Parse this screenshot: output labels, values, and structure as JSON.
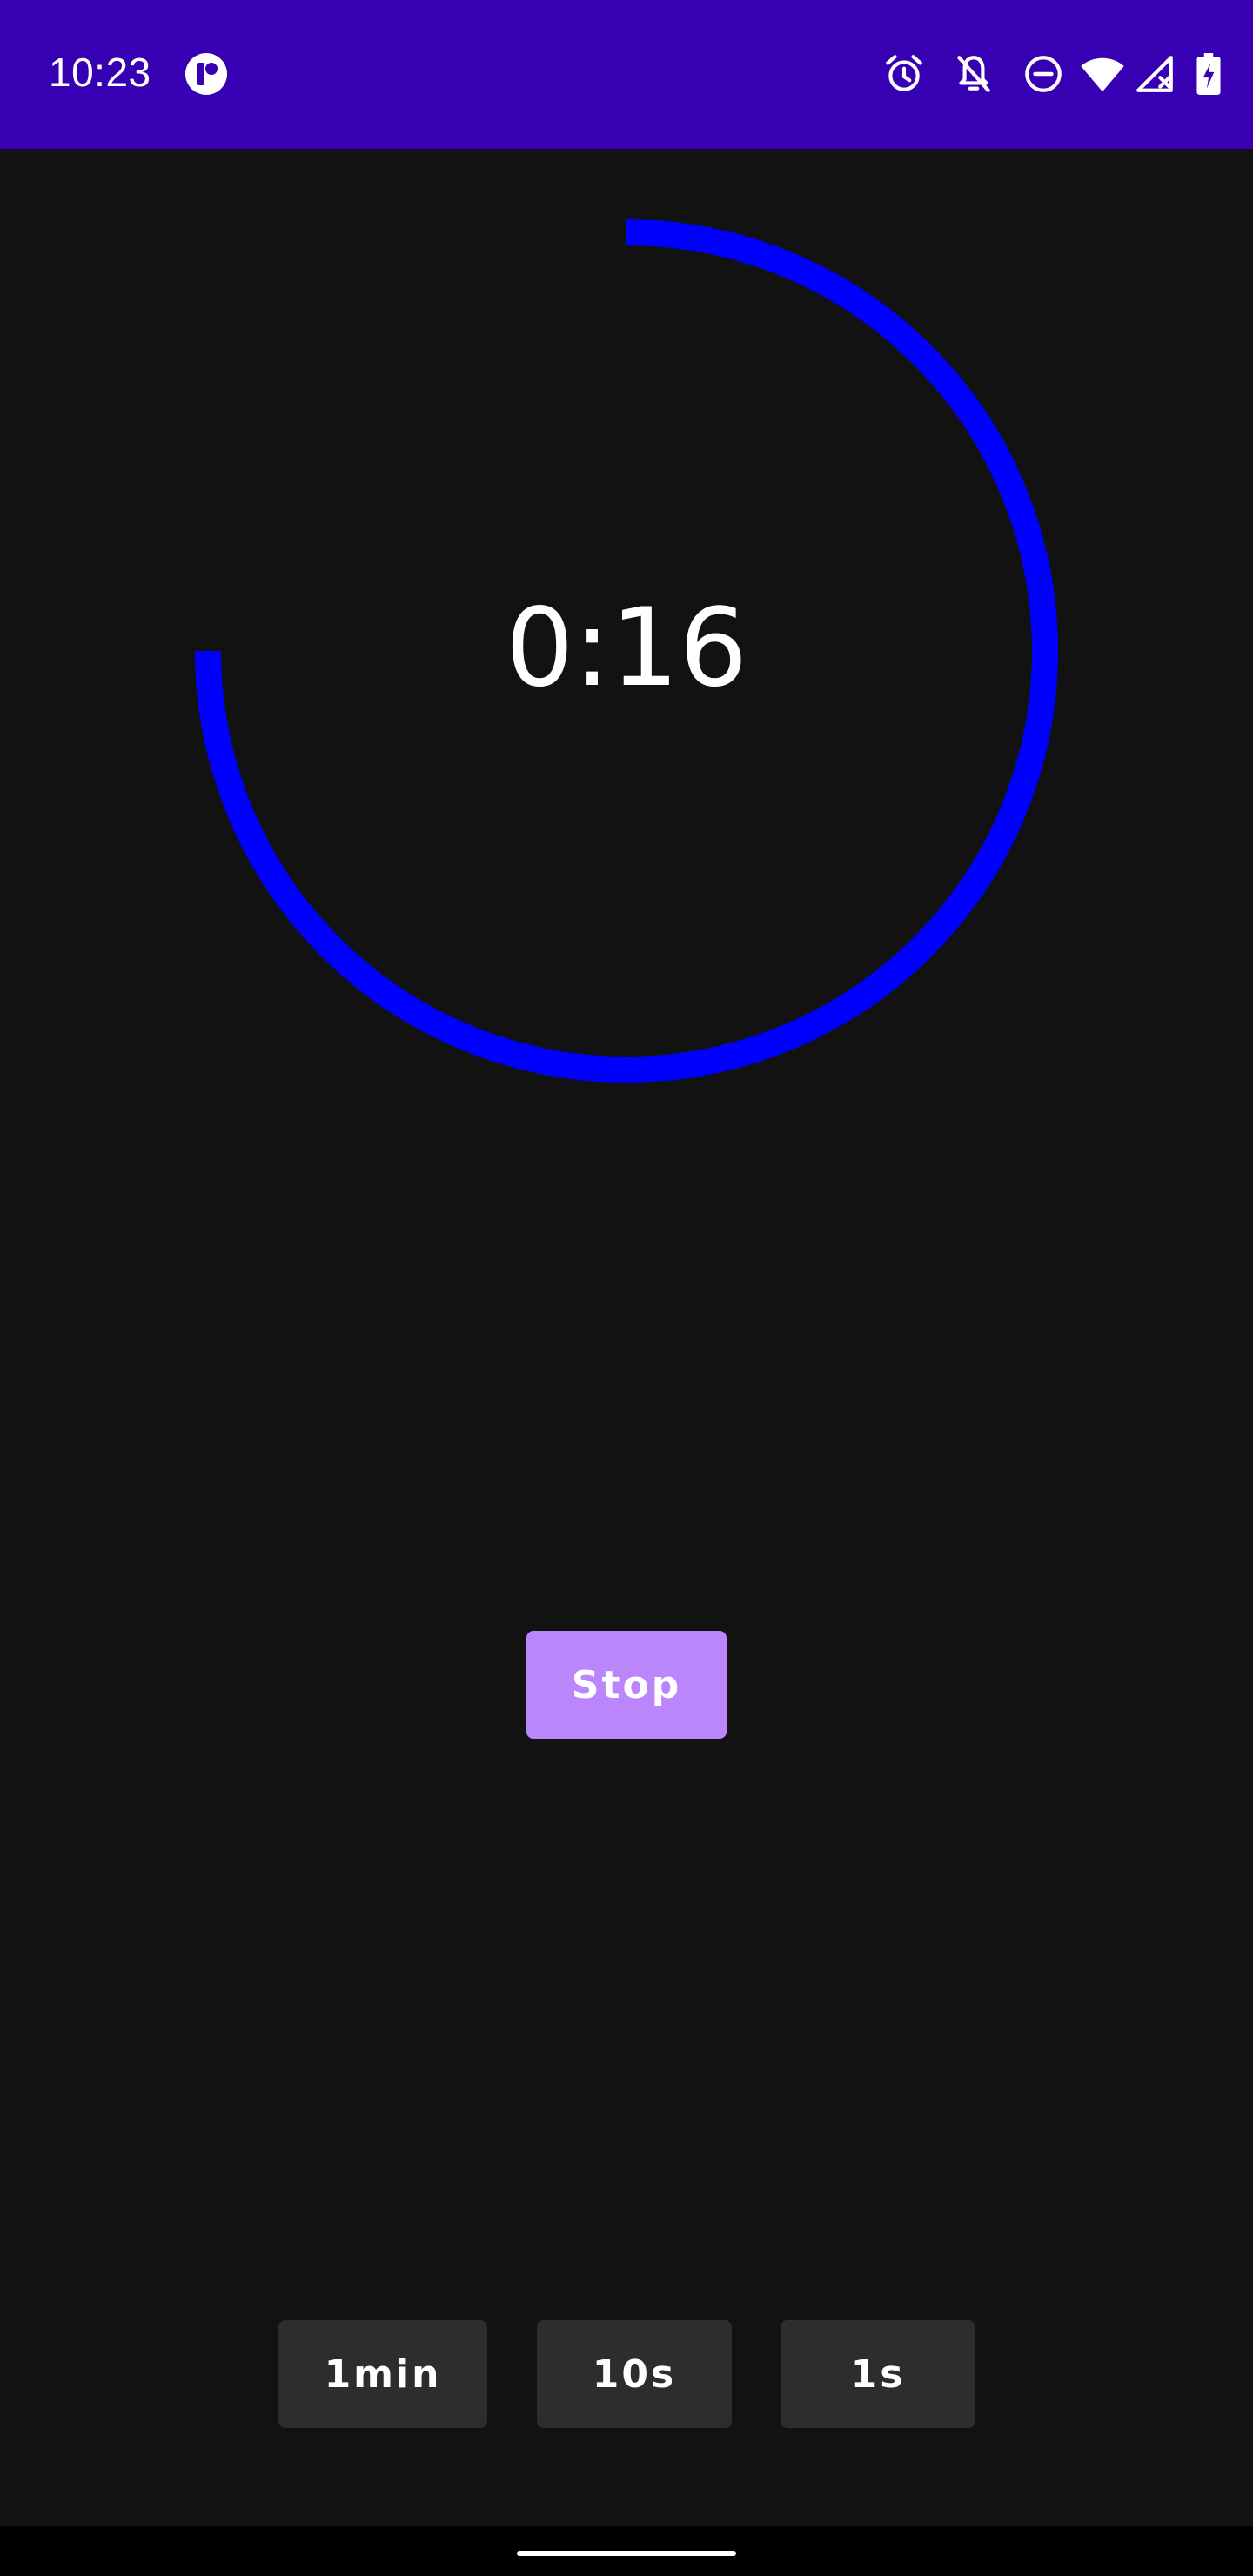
{
  "status_bar": {
    "time": "10:23",
    "background": "#3700b3",
    "icons": [
      "app-notification-icon",
      "alarm-icon",
      "notifications-off-icon",
      "do-not-disturb-icon",
      "wifi-icon",
      "no-signal-icon",
      "battery-charging-icon"
    ]
  },
  "timer": {
    "display": "0:16",
    "progress_fraction": 0.75,
    "ring_color": "#0000ff"
  },
  "controls": {
    "stop_label": "Stop",
    "stop_color": "#bb86fc"
  },
  "adjust_buttons": {
    "one_min": "1min",
    "ten_sec": "10s",
    "one_sec": "1s"
  }
}
